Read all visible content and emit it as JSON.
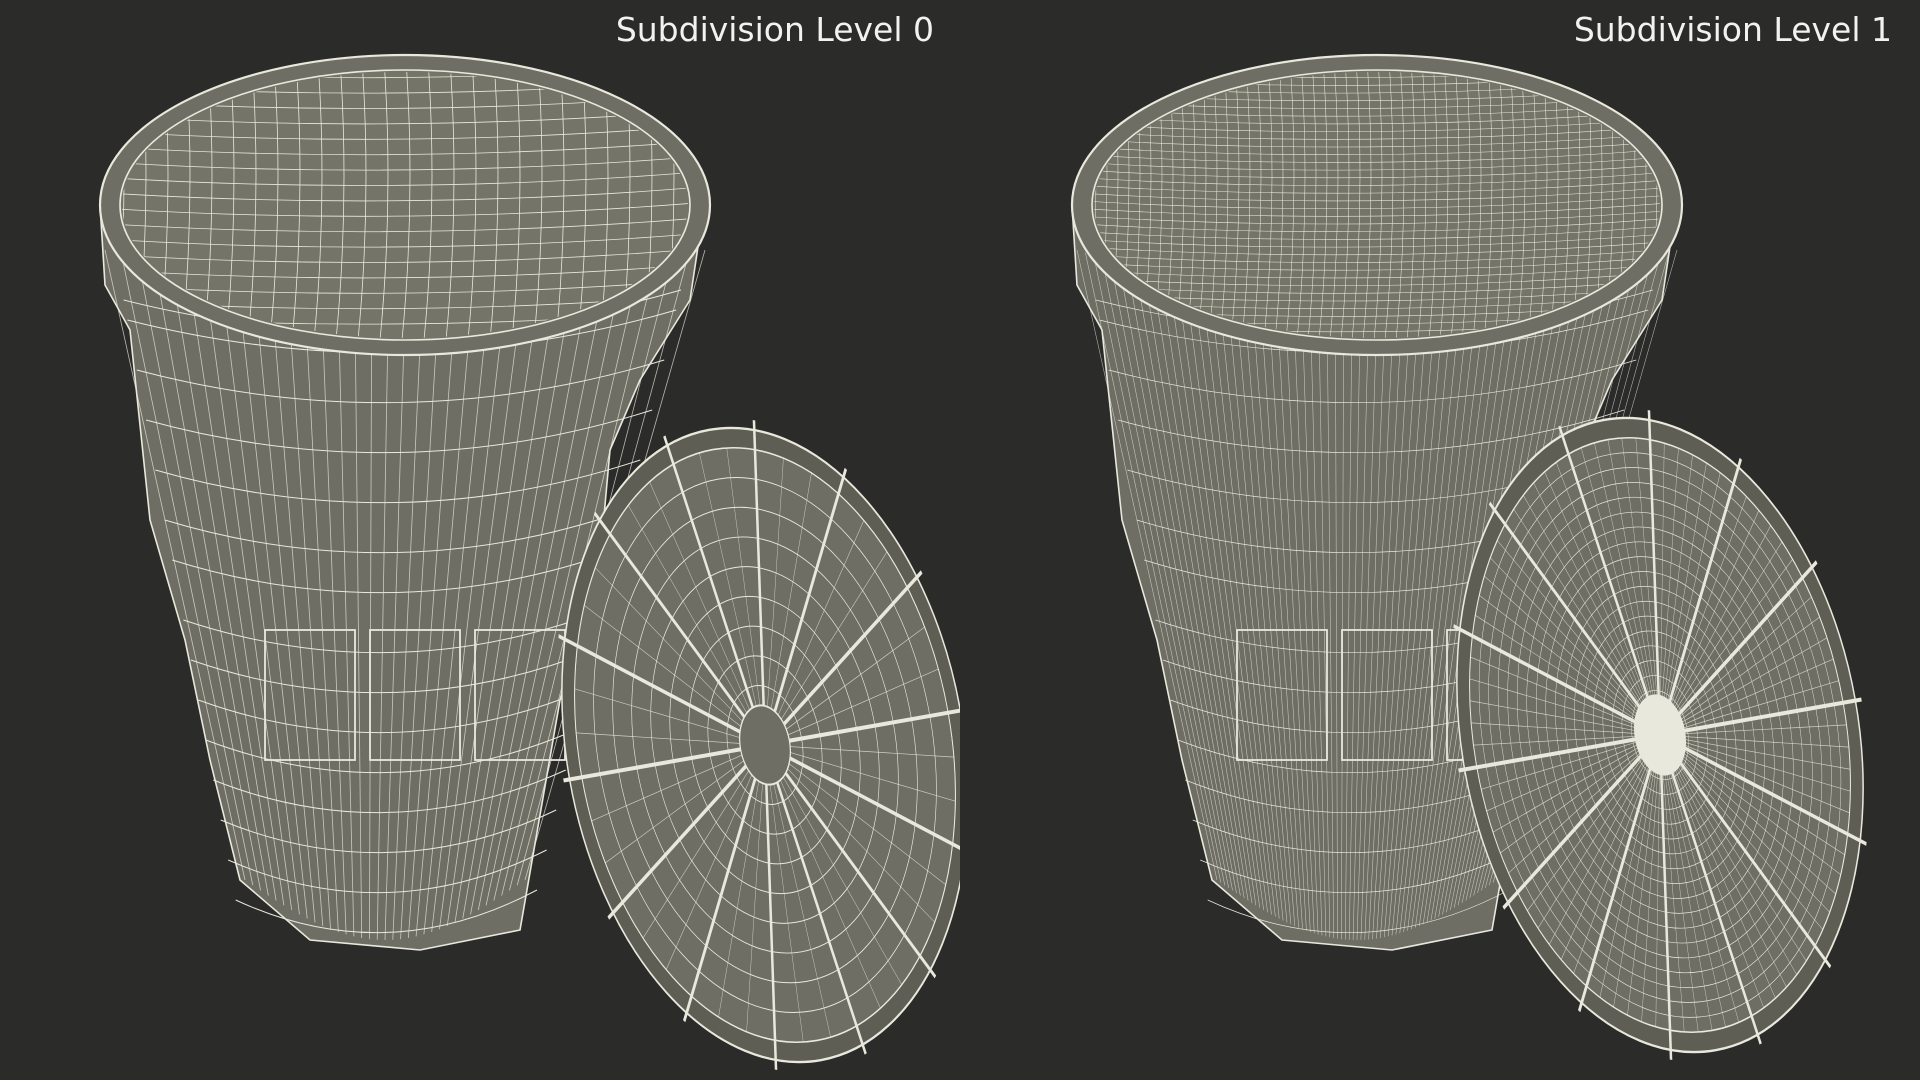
{
  "scene": {
    "background_color": "#2b2b2a",
    "mesh_fill_color": "#6e6e64",
    "wire_color": "#e8e8dc"
  },
  "panels": [
    {
      "label": "Subdivision Level 0",
      "wire_density": 1
    },
    {
      "label": "Subdivision Level 1",
      "wire_density": 2
    }
  ]
}
